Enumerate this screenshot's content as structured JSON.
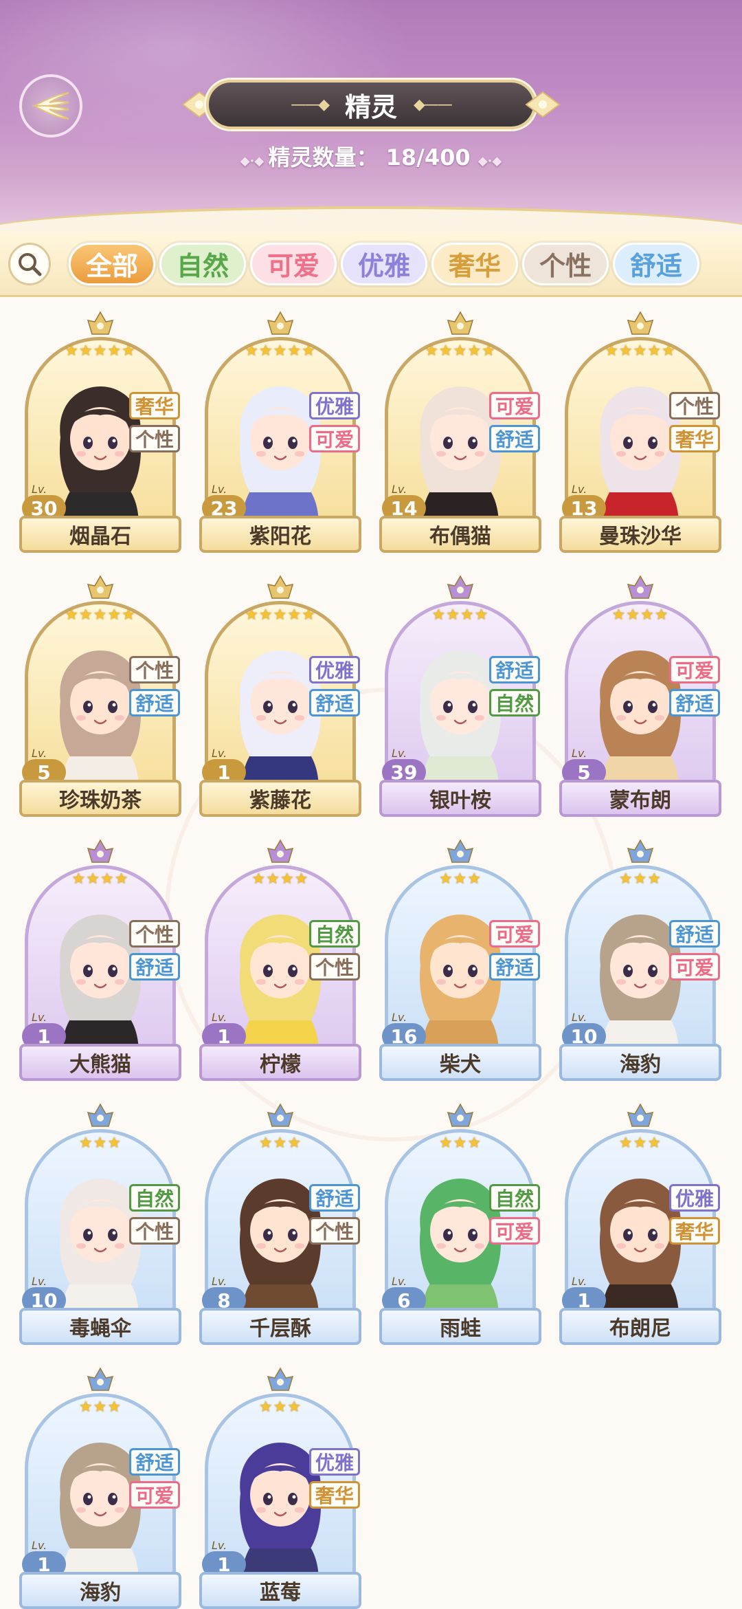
{
  "header": {
    "title": "精灵",
    "count_label": "精灵数量：",
    "count_value": "18/400"
  },
  "filters": [
    {
      "label": "全部",
      "selected": true,
      "color": "#f0a54a",
      "bg": "#f8d190"
    },
    {
      "label": "自然",
      "selected": false,
      "color": "#58a84a",
      "bg": "#dff0cd"
    },
    {
      "label": "可爱",
      "selected": false,
      "color": "#f0708a",
      "bg": "#fde0e5"
    },
    {
      "label": "优雅",
      "selected": false,
      "color": "#8d80d8",
      "bg": "#e6e2fb"
    },
    {
      "label": "奢华",
      "selected": false,
      "color": "#d79e3c",
      "bg": "#fcebc6"
    },
    {
      "label": "个性",
      "selected": false,
      "color": "#8a7262",
      "bg": "#efe4d9"
    },
    {
      "label": "舒适",
      "selected": false,
      "color": "#5aa0dc",
      "bg": "#dcedfb"
    }
  ],
  "tag_colors": {
    "自然": "#4f9a43",
    "可爱": "#ef6a86",
    "优雅": "#7f72cf",
    "奢华": "#cf9235",
    "个性": "#8a6e5c",
    "舒适": "#4a95d6"
  },
  "spirits": [
    {
      "name": "烟晶石",
      "level": "30",
      "stars": "★★★★★",
      "rarity": "gold",
      "tags": [
        "奢华",
        "个性"
      ],
      "hair": "#3a2d2a",
      "skin": "#ffe2cf",
      "outfit": "#2d2a2c"
    },
    {
      "name": "紫阳花",
      "level": "23",
      "stars": "★★★★★",
      "rarity": "gold",
      "tags": [
        "优雅",
        "可爱"
      ],
      "hair": "#e8ecfb",
      "skin": "#ffe6d8",
      "outfit": "#6c73c8"
    },
    {
      "name": "布偶猫",
      "level": "14",
      "stars": "★★★★★",
      "rarity": "gold",
      "tags": [
        "可爱",
        "舒适"
      ],
      "hair": "#f0e2d8",
      "skin": "#ffe8db",
      "outfit": "#2b2323"
    },
    {
      "name": "曼珠沙华",
      "level": "13",
      "stars": "★★★★★",
      "rarity": "gold",
      "tags": [
        "个性",
        "奢华"
      ],
      "hair": "#efe3ea",
      "skin": "#ffe4d8",
      "outfit": "#c8242b"
    },
    {
      "name": "珍珠奶茶",
      "level": "5",
      "stars": "★★★★★",
      "rarity": "gold",
      "tags": [
        "个性",
        "舒适"
      ],
      "hair": "#c6a896",
      "skin": "#ffe4d2",
      "outfit": "#f4ede6"
    },
    {
      "name": "紫藤花",
      "level": "1",
      "stars": "★★★★★",
      "rarity": "gold",
      "tags": [
        "优雅",
        "舒适"
      ],
      "hair": "#eeeefa",
      "skin": "#ffe6da",
      "outfit": "#36387f"
    },
    {
      "name": "银叶桉",
      "level": "39",
      "stars": "★★★★",
      "rarity": "purple",
      "tags": [
        "舒适",
        "自然"
      ],
      "hair": "#e9ebe8",
      "skin": "#ffe8de",
      "outfit": "#dfe9d4"
    },
    {
      "name": "蒙布朗",
      "level": "5",
      "stars": "★★★★",
      "rarity": "purple",
      "tags": [
        "可爱",
        "舒适"
      ],
      "hair": "#b98356",
      "skin": "#ffe2cf",
      "outfit": "#f0d5a6"
    },
    {
      "name": "大熊猫",
      "level": "1",
      "stars": "★★★★",
      "rarity": "purple",
      "tags": [
        "个性",
        "舒适"
      ],
      "hair": "#d8d4d2",
      "skin": "#ffe6d8",
      "outfit": "#2c2729"
    },
    {
      "name": "柠檬",
      "level": "1",
      "stars": "★★★★",
      "rarity": "purple",
      "tags": [
        "自然",
        "个性"
      ],
      "hair": "#f1dc77",
      "skin": "#ffe6d4",
      "outfit": "#f2d34a"
    },
    {
      "name": "柴犬",
      "level": "16",
      "stars": "★★★",
      "rarity": "blue",
      "tags": [
        "可爱",
        "舒适"
      ],
      "hair": "#e8b36d",
      "skin": "#ffe4cf",
      "outfit": "#d9a05a"
    },
    {
      "name": "海豹",
      "level": "10",
      "stars": "★★★",
      "rarity": "blue",
      "tags": [
        "舒适",
        "可爱"
      ],
      "hair": "#b7a28c",
      "skin": "#ffe6d8",
      "outfit": "#f3efea"
    },
    {
      "name": "毒蝇伞",
      "level": "10",
      "stars": "★★★",
      "rarity": "blue",
      "tags": [
        "自然",
        "个性"
      ],
      "hair": "#efe8e4",
      "skin": "#ffe7dc",
      "outfit": "#f4f0ec"
    },
    {
      "name": "千层酥",
      "level": "8",
      "stars": "★★★",
      "rarity": "blue",
      "tags": [
        "舒适",
        "个性"
      ],
      "hair": "#5b3c2c",
      "skin": "#ffe4d2",
      "outfit": "#6f4b32"
    },
    {
      "name": "雨蛙",
      "level": "6",
      "stars": "★★★",
      "rarity": "blue",
      "tags": [
        "自然",
        "可爱"
      ],
      "hair": "#58b567",
      "skin": "#ffe8da",
      "outfit": "#7fc271"
    },
    {
      "name": "布朗尼",
      "level": "1",
      "stars": "★★★",
      "rarity": "blue",
      "tags": [
        "优雅",
        "奢华"
      ],
      "hair": "#8a5a3e",
      "skin": "#ffe3d0",
      "outfit": "#3b2923"
    },
    {
      "name": "海豹",
      "level": "1",
      "stars": "★★★",
      "rarity": "blue",
      "tags": [
        "舒适",
        "可爱"
      ],
      "hair": "#b7a28c",
      "skin": "#ffe6d8",
      "outfit": "#f3efea"
    },
    {
      "name": "蓝莓",
      "level": "1",
      "stars": "★★★",
      "rarity": "blue",
      "tags": [
        "优雅",
        "奢华"
      ],
      "hair": "#4b3c9a",
      "skin": "#ffe4d6",
      "outfit": "#3c3a78"
    }
  ]
}
